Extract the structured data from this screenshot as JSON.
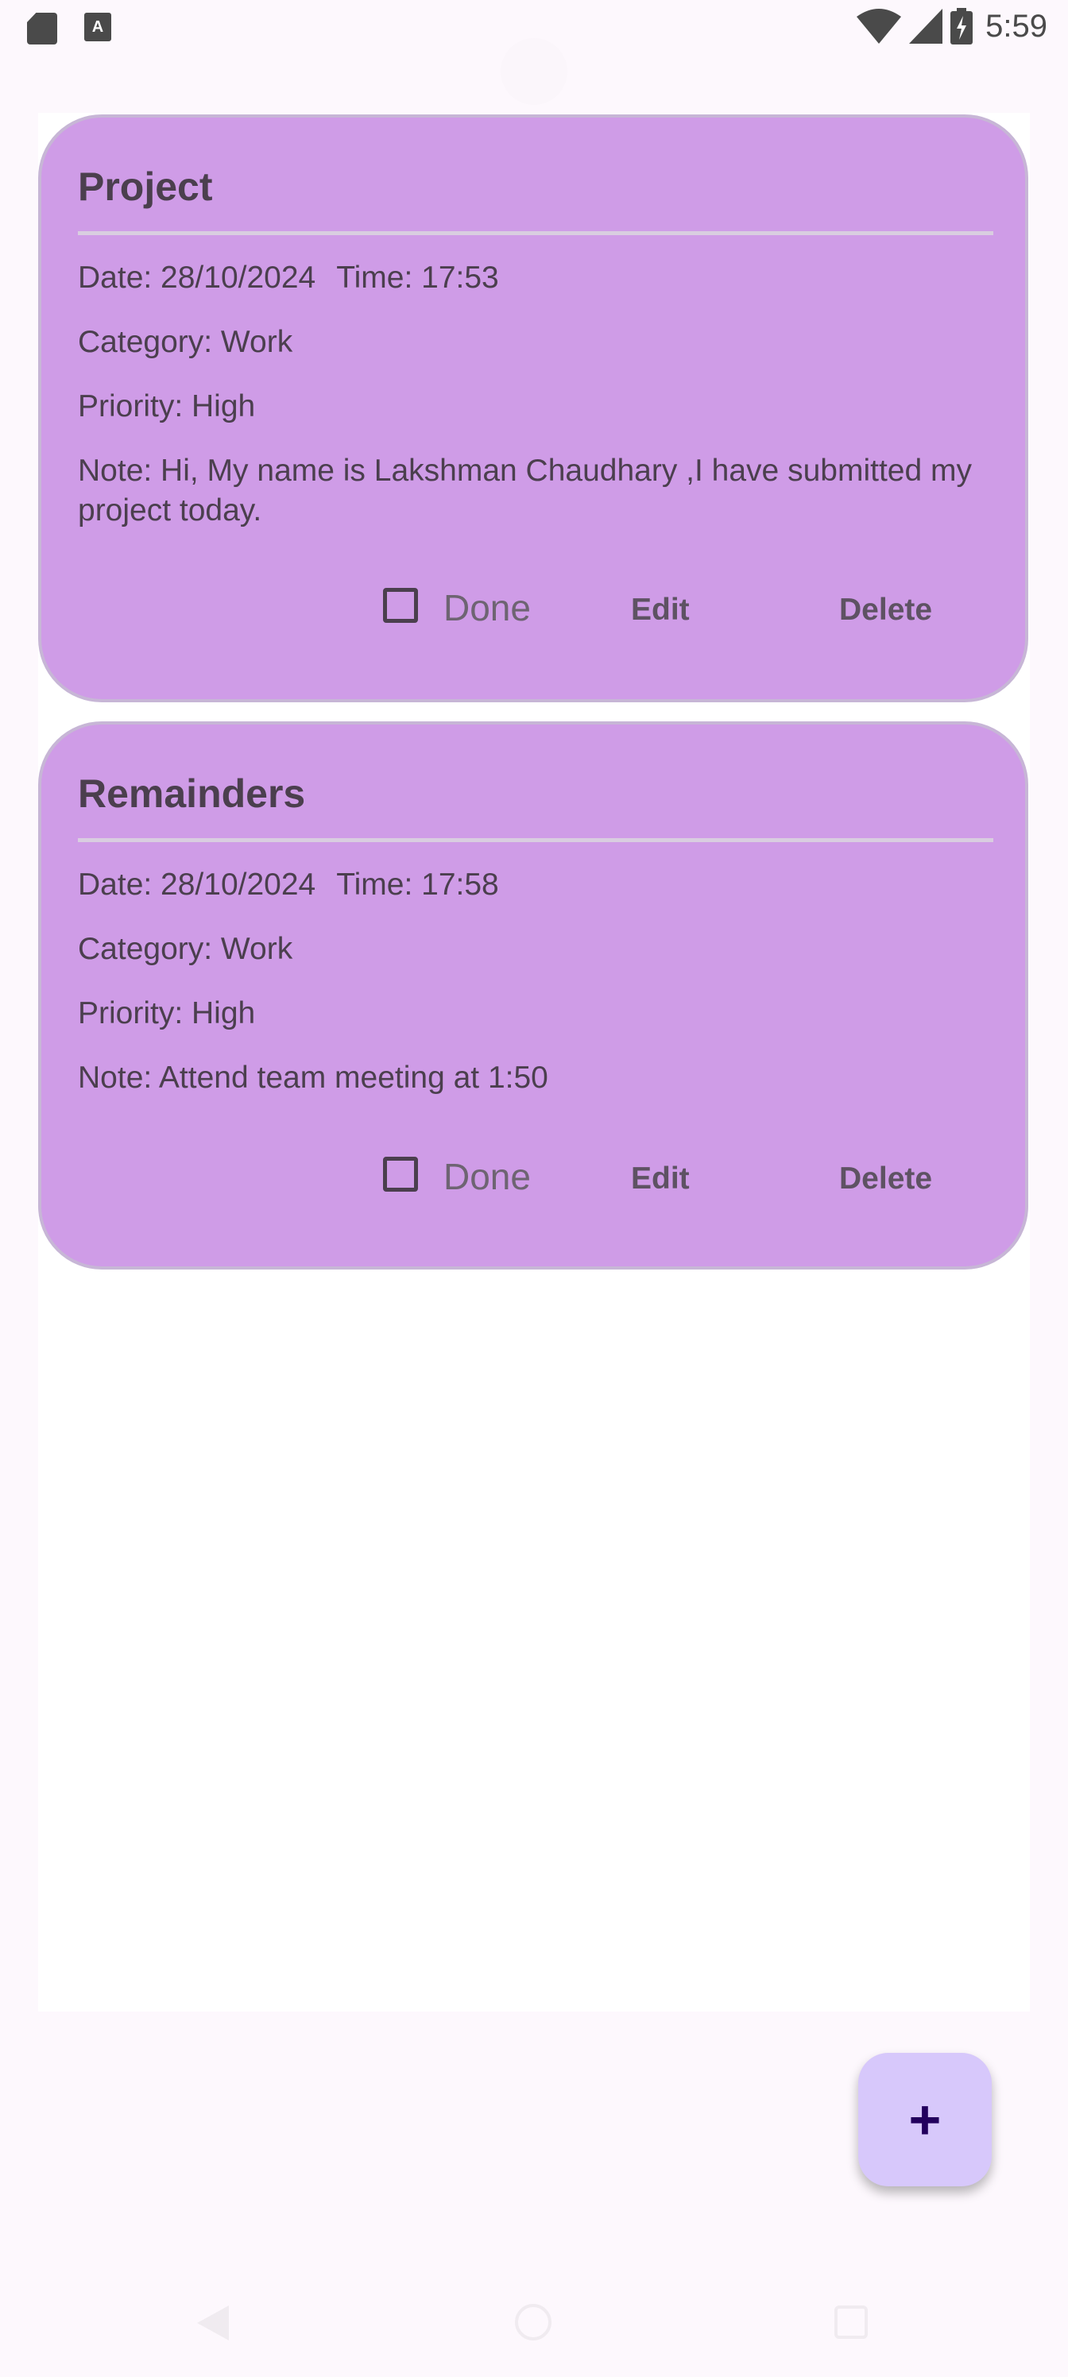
{
  "status_bar": {
    "time": "5:59",
    "icons": [
      "sd-card-icon",
      "text-a-icon",
      "wifi-icon",
      "signal-icon",
      "battery-charging-icon"
    ]
  },
  "notes": [
    {
      "title": "Project",
      "date": "Date: 28/10/2024",
      "time": "Time: 17:53",
      "category": "Category: Work",
      "priority": "Priority: High",
      "note": "Note: Hi, My name is Lakshman Chaudhary ,I have submitted my project today.",
      "done_label": "Done",
      "done_checked": false,
      "edit_label": "Edit",
      "delete_label": "Delete"
    },
    {
      "title": "Remainders",
      "date": "Date: 28/10/2024",
      "time": "Time: 17:58",
      "category": "Category: Work",
      "priority": "Priority: High",
      "note": "Note: Attend team meeting at 1:50",
      "done_label": "Done",
      "done_checked": false,
      "edit_label": "Edit",
      "delete_label": "Delete"
    }
  ],
  "fab": {
    "icon": "plus-icon",
    "label": "+"
  },
  "colors": {
    "card": "#cf9ce7",
    "card_border": "#c7b6d6",
    "fab": "#d7c8fb",
    "background": "#fdf8fd"
  }
}
